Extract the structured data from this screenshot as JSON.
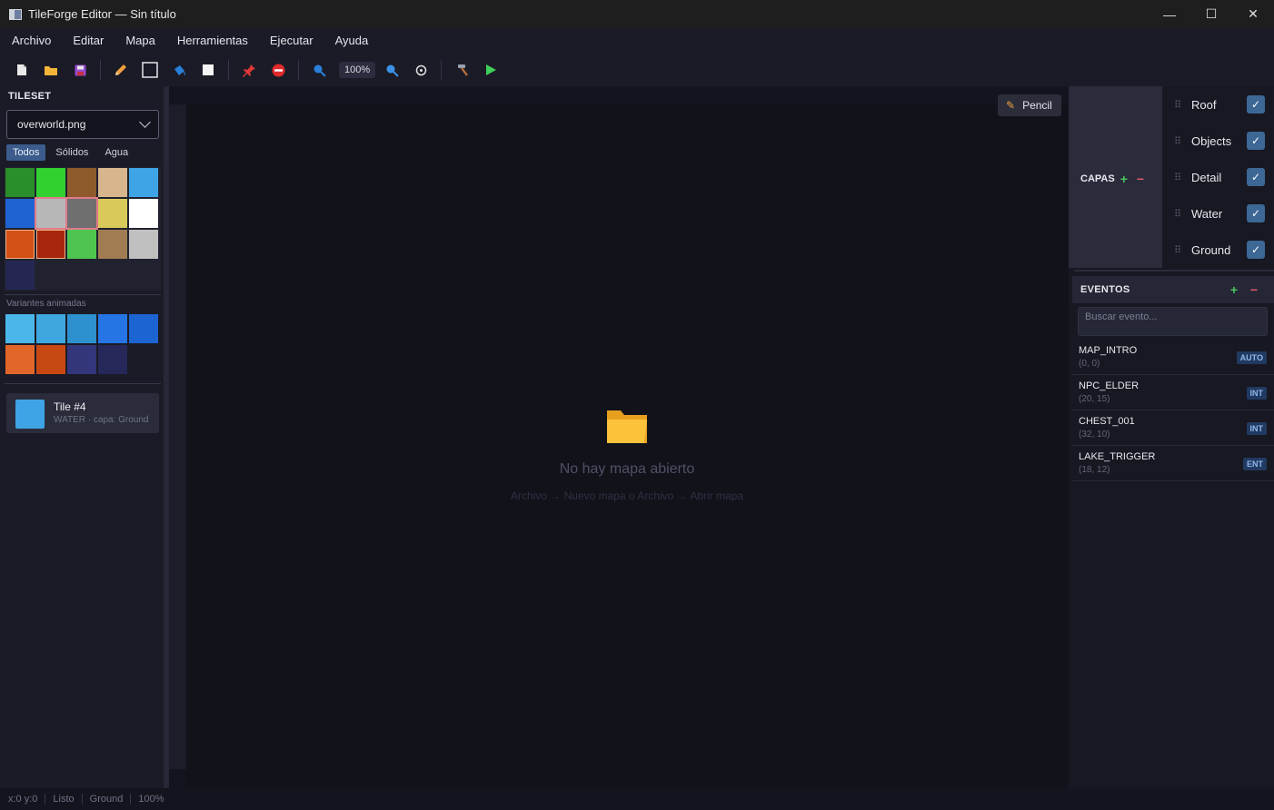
{
  "window": {
    "title": "TileForge Editor — Sin título",
    "minimize": "—",
    "maximize": "☐",
    "close": "✕"
  },
  "menu": [
    "Archivo",
    "Editar",
    "Mapa",
    "Herramientas",
    "Ejecutar",
    "Ayuda"
  ],
  "toolbar": {
    "zoom": "100%"
  },
  "tileset": {
    "heading": "TILESET",
    "file": "overworld.png",
    "tabs": [
      "Todos",
      "Sólidos",
      "Agua"
    ],
    "active_tab": "Todos",
    "tile_colors": [
      "#2a8f2a",
      "#32d132",
      "#8d5a2b",
      "#d7b58d",
      "#3fa4e6",
      "#1f62d1",
      "#b7b7b7",
      "#6f6f6f",
      "#d9c95a",
      "#ffffff",
      "#d35016",
      "#a8270c",
      "#4fc54f",
      "#a17c52",
      "#c0c0c0",
      "#252752"
    ],
    "selected_tiles": [
      6,
      7
    ],
    "anim_label": "Variantes animadas",
    "anim_colors": [
      "#4bb6ea",
      "#3ea7df",
      "#2d90cf",
      "#2576e4",
      "#1c64d2",
      "#e2652a",
      "#c84814",
      "#33367a",
      "#26285a"
    ],
    "selected_tile": {
      "name": "Tile #4",
      "meta": "WATER · capa: Ground",
      "color": "#3fa4e6"
    }
  },
  "canvas": {
    "tool_badge": "Pencil",
    "empty_title": "No hay mapa abierto",
    "empty_hint": "Archivo → Nuevo mapa  o  Archivo → Abrir mapa"
  },
  "layers": {
    "heading": "CAPAS",
    "add": "+",
    "remove": "−",
    "items": [
      {
        "name": "Roof",
        "visible": true
      },
      {
        "name": "Objects",
        "visible": true
      },
      {
        "name": "Detail",
        "visible": true
      },
      {
        "name": "Water",
        "visible": true
      },
      {
        "name": "Ground",
        "visible": true
      }
    ]
  },
  "events": {
    "heading": "EVENTOS",
    "add": "+",
    "remove": "−",
    "search_placeholder": "Buscar evento...",
    "items": [
      {
        "name": "MAP_INTRO",
        "pos": "(0, 0)",
        "badge": "AUTO"
      },
      {
        "name": "NPC_ELDER",
        "pos": "(20, 15)",
        "badge": "INT"
      },
      {
        "name": "CHEST_001",
        "pos": "(32, 10)",
        "badge": "INT"
      },
      {
        "name": "LAKE_TRIGGER",
        "pos": "(18, 12)",
        "badge": "ENT"
      }
    ]
  },
  "status": {
    "coords": "x:0 y:0",
    "state": "Listo",
    "layer": "Ground",
    "zoom": "100%"
  }
}
